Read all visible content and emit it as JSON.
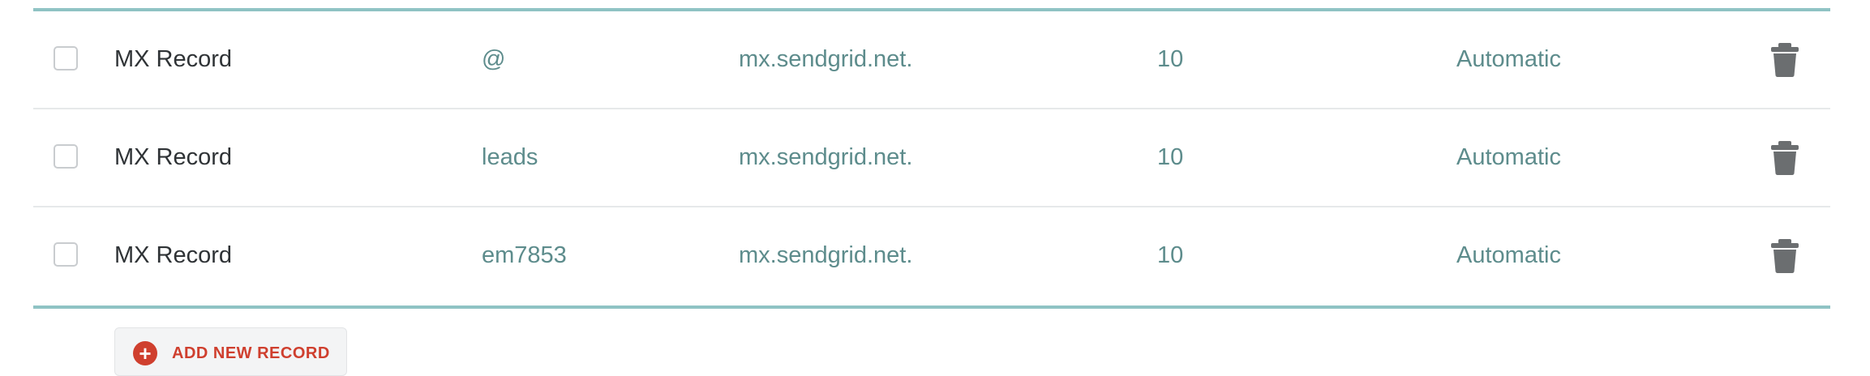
{
  "records": [
    {
      "type": "MX Record",
      "host": "@",
      "value": "mx.sendgrid.net.",
      "priority": "10",
      "ttl": "Automatic"
    },
    {
      "type": "MX Record",
      "host": "leads",
      "value": "mx.sendgrid.net.",
      "priority": "10",
      "ttl": "Automatic"
    },
    {
      "type": "MX Record",
      "host": "em7853",
      "value": "mx.sendgrid.net.",
      "priority": "10",
      "ttl": "Automatic"
    }
  ],
  "add_button": {
    "icon": "plus-circle-icon",
    "label": "ADD NEW RECORD"
  },
  "icons": {
    "delete": "trash-icon"
  },
  "colors": {
    "accent_border": "#8fc3c4",
    "link_text": "#5d8c8c",
    "danger": "#cf3f2e",
    "trash": "#6b6e70"
  }
}
